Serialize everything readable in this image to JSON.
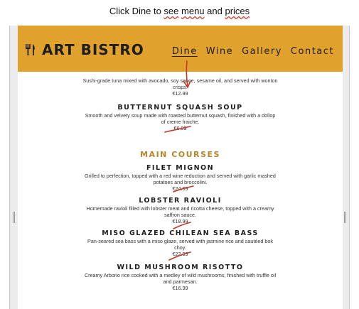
{
  "instruction": {
    "prefix": "Click Dine to ",
    "word_see": "see",
    "middle": " ",
    "word_menu": "menu",
    "and": " and ",
    "word_prices": "prices"
  },
  "site": {
    "logo_text": "ART BISTRO",
    "brand_color": "#e0a22c",
    "nav": [
      "Dine",
      "Wine",
      "Gallery",
      "Contact"
    ],
    "active_nav": "Dine"
  },
  "menu": {
    "partial_item": {
      "desc": "Sushi-grade tuna mixed with avocado, soy sauce, sesame oil, and served with wonton crisps.",
      "price": "€12.99"
    },
    "soup": {
      "name": "BUTTERNUT SQUASH SOUP",
      "desc": "Smooth and velvety soup made with roasted butternut squash, finished with a dollop of creme fraiche.",
      "price": "€6.99"
    },
    "main_heading": "MAIN COURSES",
    "mains": [
      {
        "name": "FILET MIGNON",
        "desc": "Grilled to perfection, topped with a red wine reduction and served with garlic mashed potatoes and broccolini.",
        "price": "€24.99"
      },
      {
        "name": "LOBSTER RAVIOLI",
        "desc": "Homemade ravioli filled with lobster meat and ricotta cheese, topped with a creamy saffron sauce.",
        "price": "€18.99"
      },
      {
        "name": "MISO GLAZED CHILEAN SEA BASS",
        "desc": "Pan-seared sea bass with a miso glaze, served with jasmine rice and sautéed bok choy.",
        "price": "€22.99"
      },
      {
        "name": "WILD MUSHROOM RISOTTO",
        "desc": "Creamy Arborio rice cooked with a medley of wild mushrooms, finished with truffle oil and parmesan.",
        "price": "€16.99"
      }
    ]
  },
  "annotation_color": "#c0392b"
}
